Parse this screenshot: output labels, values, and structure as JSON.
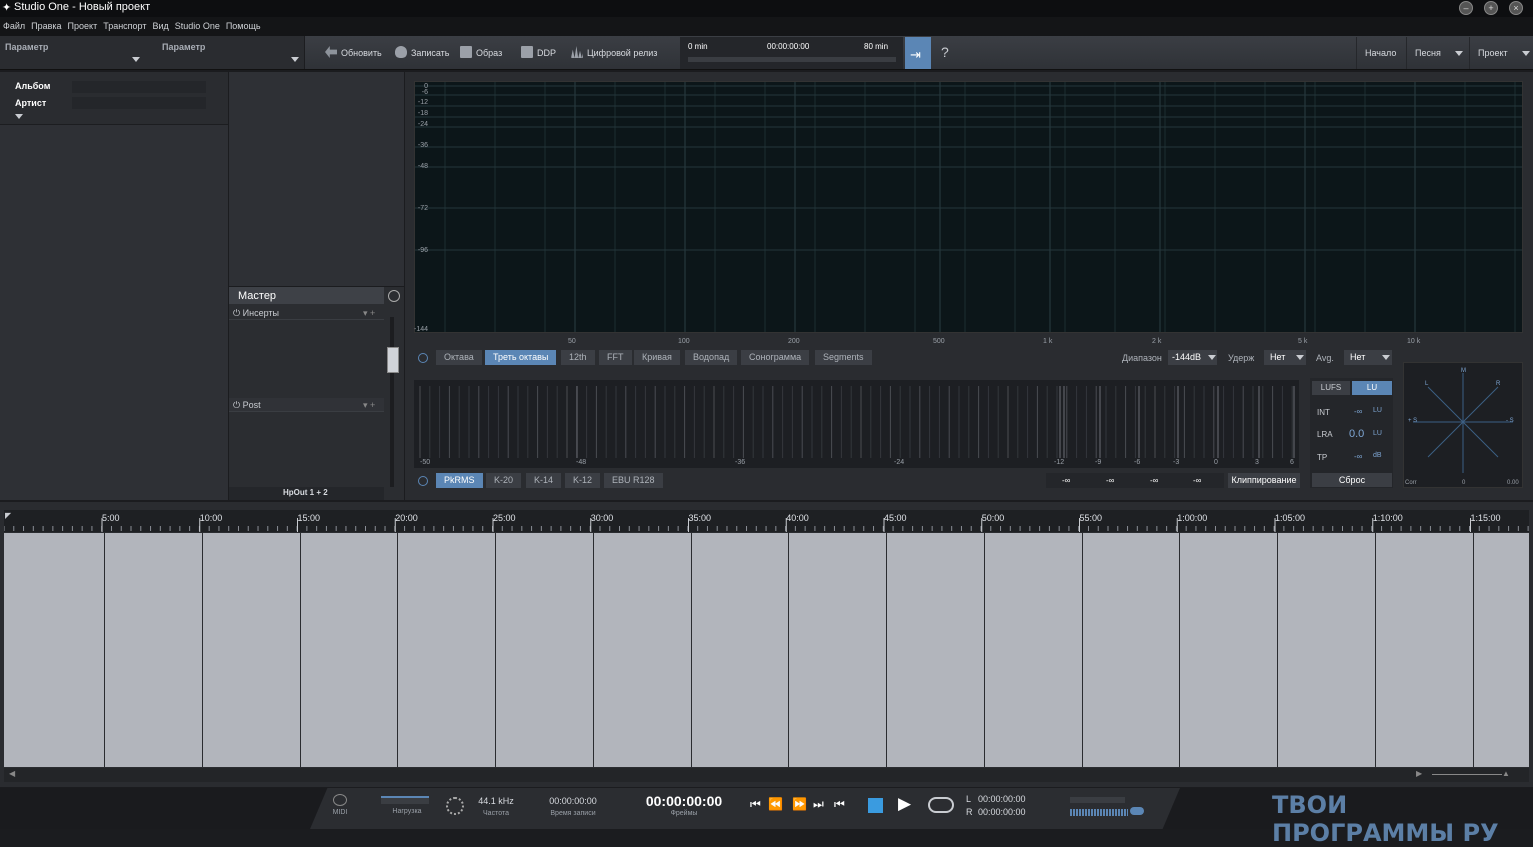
{
  "window": {
    "title": "Studio One - Новый проект"
  },
  "menu": [
    "Файл",
    "Правка",
    "Проект",
    "Транспорт",
    "Вид",
    "Studio One",
    "Помощь"
  ],
  "toolbar": {
    "param1": "Параметр",
    "param2": "Параметр",
    "update": "Обновить",
    "record": "Записать",
    "image": "Образ",
    "ddp": "DDP",
    "digital": "Цифровой релиз",
    "help": "?"
  },
  "mini_transport": {
    "start": "0 min",
    "time": "00:00:00:00",
    "end": "80 min"
  },
  "nav": {
    "start": "Начало",
    "song": "Песня",
    "project": "Проект"
  },
  "metadata": {
    "album_label": "Альбом",
    "artist_label": "Артист"
  },
  "mixer": {
    "title": "Мастер",
    "inserts": "Инсерты",
    "post": "Post",
    "output": "HpOut 1 + 2"
  },
  "spectrum": {
    "y_labels": [
      "0",
      "-6",
      "-12",
      "-18",
      "-24",
      "-36",
      "-48",
      "-72",
      "-96",
      "-144"
    ],
    "x_labels": [
      "50",
      "100",
      "200",
      "500",
      "1 k",
      "2 k",
      "5 k",
      "10 k"
    ],
    "tabs": [
      "Октава",
      "Треть октавы",
      "12th",
      "FFT",
      "Кривая",
      "Водопад",
      "Сонограмма",
      "Segments"
    ],
    "active_tab": "Треть октавы",
    "range_label": "Диапазон",
    "range_value": "-144dB",
    "hold_label": "Удерж",
    "hold_value": "Нет",
    "avg_label": "Avg.",
    "avg_value": "Нет"
  },
  "meter": {
    "labels": [
      "-50",
      "-48",
      "-36",
      "-24",
      "-12",
      "-9",
      "-6",
      "-3",
      "0",
      "3",
      "6"
    ],
    "tabs": [
      "PkRMS",
      "K-20",
      "K-14",
      "K-12",
      "EBU R128"
    ],
    "active_tab": "PkRMS",
    "values": [
      "-∞",
      "-∞",
      "-∞",
      "-∞"
    ],
    "clip": "Клиппирование"
  },
  "loudness": {
    "lufs": "LUFS",
    "lu": "LU",
    "int_label": "INT",
    "int_value": "-∞",
    "int_unit": "LU",
    "lra_label": "LRA",
    "lra_value": "0.0",
    "lra_unit": "LU",
    "tp_label": "TP",
    "tp_value": "-∞",
    "tp_unit": "dB",
    "reset": "Сброс"
  },
  "vectorscope": {
    "m": "M",
    "l": "L",
    "r": "R",
    "pos": "+ S",
    "neg": "- S",
    "corr": "Corr",
    "corr_val": "0.00",
    "zero": "0"
  },
  "timeline": {
    "marks": [
      "5:00",
      "10:00",
      "15:00",
      "20:00",
      "25:00",
      "30:00",
      "35:00",
      "40:00",
      "45:00",
      "50:00",
      "55:00",
      "1:00:00",
      "1:05:00",
      "1:10:00",
      "1:15:00"
    ]
  },
  "status": {
    "midi": "MIDI",
    "load": "Нагрузка",
    "rate": "44.1 kHz",
    "rate_label": "Частота",
    "rec_time": "00:00:00:00",
    "rec_label": "Время записи",
    "time": "00:00:00:00",
    "frames": "Фреймы",
    "l_label": "L",
    "l_time": "00:00:00:00",
    "r_label": "R",
    "r_time": "00:00:00:00"
  },
  "watermark": "ТВОИ ПРОГРАММЫ РУ",
  "colors": {
    "accent": "#5b86b5",
    "graph_bg": "#0c1619",
    "lane": "#b2b5bc"
  }
}
